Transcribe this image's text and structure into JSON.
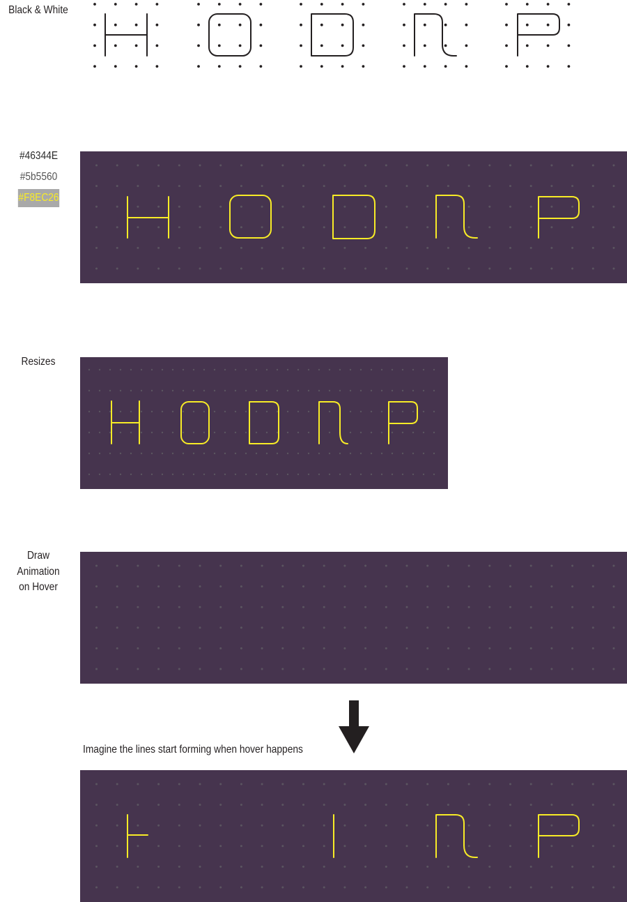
{
  "labels": {
    "black_white": "Black & White",
    "resizes": "Resizes",
    "draw_animation_lines": [
      "Draw",
      "Animation",
      "on Hover"
    ],
    "hover_note": "Imagine the lines start forming when hover happens"
  },
  "swatches": [
    {
      "text": "#46344E",
      "text_color": "#2b2b2b",
      "background": "transparent"
    },
    {
      "text": "#5b5560",
      "text_color": "#555555",
      "background": "transparent"
    },
    {
      "text": "#F8EC26",
      "text_color": "#F8EC26",
      "background": "#a9a9a9"
    }
  ],
  "colors": {
    "panel": "#46344E",
    "dot": "#5b5560",
    "accent": "#F8EC26",
    "ink": "#231f20"
  },
  "letters": [
    "H",
    "O",
    "D",
    "N",
    "P"
  ],
  "partial_letters": [
    "H-partial",
    "I",
    "N",
    "P"
  ]
}
